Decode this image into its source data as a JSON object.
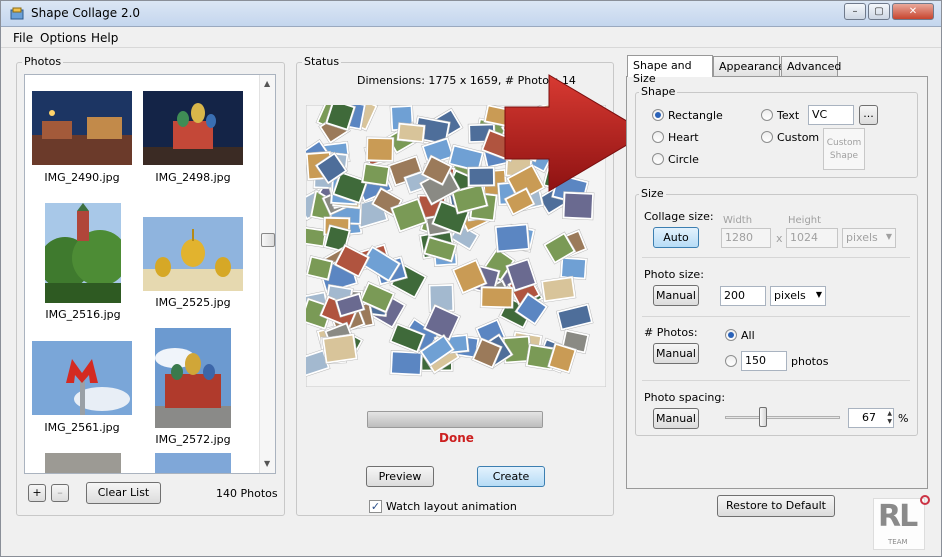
{
  "window": {
    "title": "Shape Collage 2.0",
    "controls": [
      "–",
      "▢",
      "✕"
    ]
  },
  "menu": [
    "File",
    "Options",
    "Help"
  ],
  "photos_panel": {
    "label": "Photos",
    "items": [
      {
        "name": "IMG_2490.jpg"
      },
      {
        "name": "IMG_2498.jpg"
      },
      {
        "name": "IMG_2516.jpg"
      },
      {
        "name": "IMG_2525.jpg"
      },
      {
        "name": "IMG_2561.jpg"
      },
      {
        "name": "IMG_2572.jpg"
      }
    ],
    "add_label": "+",
    "remove_label": "–",
    "clear_label": "Clear List",
    "count": "140 Photos"
  },
  "status_panel": {
    "label": "Status",
    "dimensions": "Dimensions: 1775 x 1659, # Photos: 14",
    "progress": 1.0,
    "done": "Done",
    "preview_label": "Preview",
    "create_label": "Create",
    "watch_label": "Watch layout animation",
    "watch_checked": true
  },
  "tabs": [
    "Shape and Size",
    "Appearance",
    "Advanced"
  ],
  "shape": {
    "label": "Shape",
    "rectangle": "Rectangle",
    "heart": "Heart",
    "circle": "Circle",
    "text": "Text",
    "text_value": "VC",
    "browse": "...",
    "custom": "Custom",
    "custom_shape": "Custom Shape"
  },
  "size": {
    "label": "Size",
    "collage_size": "Collage size:",
    "auto": "Auto",
    "width_label": "Width",
    "height_label": "Height",
    "width": "1280",
    "x": "x",
    "height": "1024",
    "units": "pixels",
    "photo_size": "Photo size:",
    "manual": "Manual",
    "photo_size_value": "200",
    "photo_units": "pixels",
    "num_photos": "# Photos:",
    "all": "All",
    "photos_value": "150",
    "photos_unit": "photos",
    "spacing": "Photo spacing:",
    "spacing_value": "67",
    "percent": "%",
    "spacing_level": 0.67
  },
  "restore_label": "Restore to Default",
  "watermark": {
    "text": "RL",
    "sub": "TEAM"
  },
  "colors": {
    "done": "#cc2020",
    "arrow": "#b81a1a",
    "accent": "#3c7fb1"
  }
}
